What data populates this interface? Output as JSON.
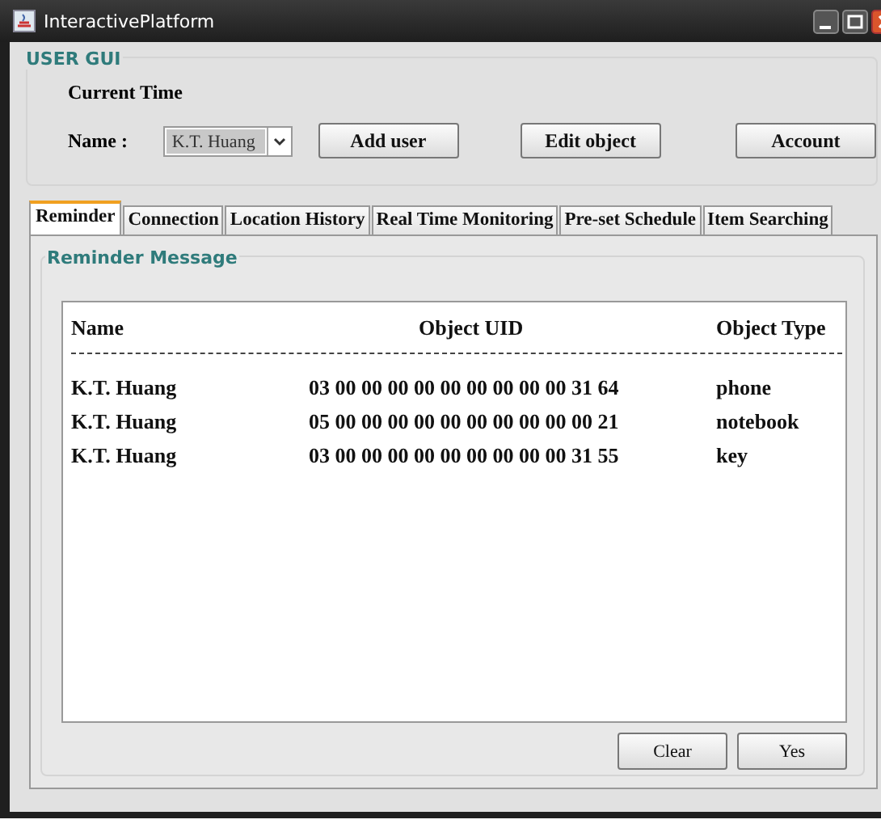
{
  "window": {
    "title": "InteractivePlatform"
  },
  "user_gui": {
    "title": "USER GUI",
    "current_time_label": "Current Time",
    "name_label": "Name :",
    "name_value": "K.T. Huang",
    "buttons": [
      "Add user",
      "Edit object",
      "Account"
    ]
  },
  "tabs": [
    {
      "label": "Reminder",
      "selected": true
    },
    {
      "label": "Connection",
      "selected": false
    },
    {
      "label": "Location History",
      "selected": false
    },
    {
      "label": "Real Time Monitoring",
      "selected": false
    },
    {
      "label": "Pre-set Schedule",
      "selected": false
    },
    {
      "label": "Item Searching",
      "selected": false
    }
  ],
  "reminder": {
    "title": "Reminder Message",
    "columns": [
      "Name",
      "Object UID",
      "Object Type"
    ],
    "rows": [
      [
        "K.T. Huang",
        "03 00 00 00 00 00 00 00 00 00 31 64",
        "phone"
      ],
      [
        "K.T. Huang",
        "05 00 00 00 00 00 00 00 00 00 00 21",
        "notebook"
      ],
      [
        "K.T. Huang",
        "03 00 00 00 00 00 00 00 00 00 31 55",
        "key"
      ]
    ],
    "buttons": [
      "Clear",
      "Yes"
    ]
  }
}
